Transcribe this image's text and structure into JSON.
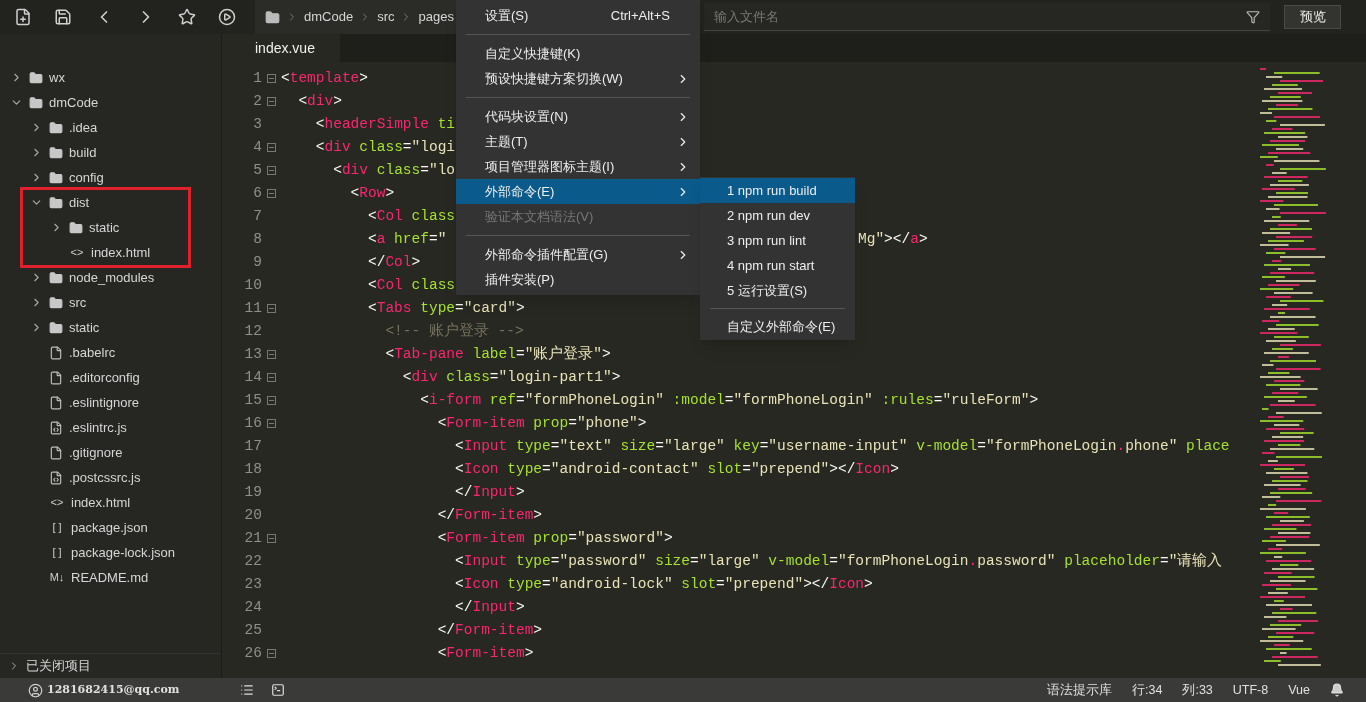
{
  "toolbar": {
    "breadcrumb": [
      "dmCode",
      "src",
      "pages"
    ],
    "search": {
      "placeholder": "输入文件名"
    },
    "preview_button": "预览"
  },
  "sidebar": {
    "tree": [
      {
        "label": "wx",
        "kind": "folder",
        "expanded": false
      },
      {
        "label": "dmCode",
        "kind": "folder",
        "expanded": true,
        "children": [
          {
            "label": ".idea",
            "kind": "folder",
            "expanded": false
          },
          {
            "label": "build",
            "kind": "folder",
            "expanded": false
          },
          {
            "label": "config",
            "kind": "folder",
            "expanded": false
          },
          {
            "label": "dist",
            "kind": "folder",
            "expanded": true,
            "highlighted": true,
            "children": [
              {
                "label": "static",
                "kind": "folder",
                "expanded": false
              },
              {
                "label": "index.html",
                "kind": "markup",
                "glyph": "<>"
              }
            ]
          },
          {
            "label": "node_modules",
            "kind": "folder",
            "expanded": false
          },
          {
            "label": "src",
            "kind": "folder",
            "expanded": false
          },
          {
            "label": "static",
            "kind": "folder",
            "expanded": false
          },
          {
            "label": ".babelrc",
            "kind": "file"
          },
          {
            "label": ".editorconfig",
            "kind": "file"
          },
          {
            "label": ".eslintignore",
            "kind": "file"
          },
          {
            "label": ".eslintrc.js",
            "kind": "script"
          },
          {
            "label": ".gitignore",
            "kind": "file"
          },
          {
            "label": ".postcssrc.js",
            "kind": "script"
          },
          {
            "label": "index.html",
            "kind": "markup",
            "glyph": "<>"
          },
          {
            "label": "package.json",
            "kind": "json",
            "glyph": "[ ]"
          },
          {
            "label": "package-lock.json",
            "kind": "json",
            "glyph": "[ ]"
          },
          {
            "label": "README.md",
            "kind": "markdown",
            "glyph": "M↓"
          }
        ]
      }
    ],
    "closed_projects": {
      "label": "已关闭项目",
      "expanded": false
    }
  },
  "tabs": [
    {
      "label": "index.vue",
      "selected": true
    }
  ],
  "editor": {
    "lines": [
      {
        "number": "1",
        "fold": true,
        "tokens": [
          {
            "kind": "punct",
            "text": "<"
          },
          {
            "kind": "tag",
            "text": "template"
          },
          {
            "kind": "punct",
            "text": ">"
          }
        ]
      },
      {
        "number": "2",
        "fold": true,
        "tokens": [
          {
            "kind": "punct",
            "text": "  <"
          },
          {
            "kind": "tag",
            "text": "div"
          },
          {
            "kind": "punct",
            "text": ">"
          }
        ]
      },
      {
        "number": "3",
        "fold": false,
        "tokens": [
          {
            "kind": "punct",
            "text": "    <"
          },
          {
            "kind": "tag",
            "text": "headerSimple"
          },
          {
            "kind": "attr",
            "text": " ti"
          }
        ]
      },
      {
        "number": "4",
        "fold": true,
        "tokens": [
          {
            "kind": "punct",
            "text": "    <"
          },
          {
            "kind": "tag",
            "text": "div"
          },
          {
            "kind": "attr",
            "text": " class"
          },
          {
            "kind": "punct",
            "text": "="
          },
          {
            "kind": "string",
            "text": "\"logi"
          }
        ]
      },
      {
        "number": "5",
        "fold": true,
        "tokens": [
          {
            "kind": "punct",
            "text": "      <"
          },
          {
            "kind": "tag",
            "text": "div"
          },
          {
            "kind": "attr",
            "text": " class"
          },
          {
            "kind": "punct",
            "text": "="
          },
          {
            "kind": "string",
            "text": "\"lo"
          }
        ]
      },
      {
        "number": "6",
        "fold": true,
        "tokens": [
          {
            "kind": "punct",
            "text": "        <"
          },
          {
            "kind": "tag",
            "text": "Row"
          },
          {
            "kind": "punct",
            "text": ">"
          }
        ]
      },
      {
        "number": "7",
        "fold": false,
        "tokens": [
          {
            "kind": "punct",
            "text": "          <"
          },
          {
            "kind": "tag",
            "text": "Col"
          },
          {
            "kind": "attr",
            "text": " class"
          }
        ]
      },
      {
        "number": "8",
        "fold": false,
        "tokens": [
          {
            "kind": "punct",
            "text": "          <"
          },
          {
            "kind": "tag",
            "text": "a"
          },
          {
            "kind": "attr",
            "text": " href"
          },
          {
            "kind": "punct",
            "text": "="
          },
          {
            "kind": "string",
            "text": "\""
          }
        ],
        "tail": [
          {
            "kind": "string",
            "text": "Mg\""
          },
          {
            "kind": "punct",
            "text": "></"
          },
          {
            "kind": "tag",
            "text": "a"
          },
          {
            "kind": "punct",
            "text": ">"
          }
        ]
      },
      {
        "number": "9",
        "fold": false,
        "tokens": [
          {
            "kind": "punct",
            "text": "          </"
          },
          {
            "kind": "tag",
            "text": "Col"
          },
          {
            "kind": "punct",
            "text": ">"
          }
        ]
      },
      {
        "number": "10",
        "fold": false,
        "tokens": [
          {
            "kind": "punct",
            "text": "          <"
          },
          {
            "kind": "tag",
            "text": "Col"
          },
          {
            "kind": "attr",
            "text": " class"
          }
        ]
      },
      {
        "number": "11",
        "fold": true,
        "tokens": [
          {
            "kind": "punct",
            "text": "          <"
          },
          {
            "kind": "tag",
            "text": "Tabs"
          },
          {
            "kind": "attr",
            "text": " type"
          },
          {
            "kind": "punct",
            "text": "="
          },
          {
            "kind": "string",
            "text": "\"card\""
          },
          {
            "kind": "punct",
            "text": ">"
          }
        ]
      },
      {
        "number": "12",
        "fold": false,
        "tokens": [
          {
            "kind": "comment",
            "text": "            <!-- 账户登录 -->"
          }
        ]
      },
      {
        "number": "13",
        "fold": true,
        "tokens": [
          {
            "kind": "punct",
            "text": "            <"
          },
          {
            "kind": "tag",
            "text": "Tab-pane"
          },
          {
            "kind": "attr",
            "text": " label"
          },
          {
            "kind": "punct",
            "text": "="
          },
          {
            "kind": "string",
            "text": "\"账户登录\""
          },
          {
            "kind": "punct",
            "text": ">"
          }
        ]
      },
      {
        "number": "14",
        "fold": true,
        "tokens": [
          {
            "kind": "punct",
            "text": "              <"
          },
          {
            "kind": "tag",
            "text": "div"
          },
          {
            "kind": "attr",
            "text": " class"
          },
          {
            "kind": "punct",
            "text": "="
          },
          {
            "kind": "string",
            "text": "\"login-part1\""
          },
          {
            "kind": "punct",
            "text": ">"
          }
        ]
      },
      {
        "number": "15",
        "fold": true,
        "tokens": [
          {
            "kind": "punct",
            "text": "                <"
          },
          {
            "kind": "tag",
            "text": "i-form"
          },
          {
            "kind": "attr",
            "text": " ref"
          },
          {
            "kind": "punct",
            "text": "="
          },
          {
            "kind": "string",
            "text": "\"formPhoneLogin\""
          },
          {
            "kind": "attr",
            "text": " :model"
          },
          {
            "kind": "punct",
            "text": "="
          },
          {
            "kind": "string",
            "text": "\"formPhoneLogin\""
          },
          {
            "kind": "attr",
            "text": " :rules"
          },
          {
            "kind": "punct",
            "text": "="
          },
          {
            "kind": "string",
            "text": "\"ruleForm\""
          },
          {
            "kind": "punct",
            "text": ">"
          }
        ]
      },
      {
        "number": "16",
        "fold": true,
        "tokens": [
          {
            "kind": "punct",
            "text": "                  <"
          },
          {
            "kind": "tag",
            "text": "Form-item"
          },
          {
            "kind": "attr",
            "text": " prop"
          },
          {
            "kind": "punct",
            "text": "="
          },
          {
            "kind": "string",
            "text": "\"phone\""
          },
          {
            "kind": "punct",
            "text": ">"
          }
        ]
      },
      {
        "number": "17",
        "fold": false,
        "tokens": [
          {
            "kind": "punct",
            "text": "                    <"
          },
          {
            "kind": "tag",
            "text": "Input"
          },
          {
            "kind": "attr",
            "text": " type"
          },
          {
            "kind": "punct",
            "text": "="
          },
          {
            "kind": "string",
            "text": "\"text\""
          },
          {
            "kind": "attr",
            "text": " size"
          },
          {
            "kind": "punct",
            "text": "="
          },
          {
            "kind": "string",
            "text": "\"large\""
          },
          {
            "kind": "attr",
            "text": " key"
          },
          {
            "kind": "punct",
            "text": "="
          },
          {
            "kind": "string",
            "text": "\"username-input\""
          },
          {
            "kind": "attr",
            "text": " v-model"
          },
          {
            "kind": "punct",
            "text": "="
          },
          {
            "kind": "string",
            "text": "\"formPhoneLogin"
          },
          {
            "kind": "tag",
            "text": "."
          },
          {
            "kind": "string",
            "text": "phone\""
          },
          {
            "kind": "attr",
            "text": " place"
          }
        ]
      },
      {
        "number": "18",
        "fold": false,
        "tokens": [
          {
            "kind": "punct",
            "text": "                    <"
          },
          {
            "kind": "tag",
            "text": "Icon"
          },
          {
            "kind": "attr",
            "text": " type"
          },
          {
            "kind": "punct",
            "text": "="
          },
          {
            "kind": "string",
            "text": "\"android-contact\""
          },
          {
            "kind": "attr",
            "text": " slot"
          },
          {
            "kind": "punct",
            "text": "="
          },
          {
            "kind": "string",
            "text": "\"prepend\""
          },
          {
            "kind": "punct",
            "text": "></"
          },
          {
            "kind": "tag",
            "text": "Icon"
          },
          {
            "kind": "punct",
            "text": ">"
          }
        ]
      },
      {
        "number": "19",
        "fold": false,
        "tokens": [
          {
            "kind": "punct",
            "text": "                    </"
          },
          {
            "kind": "tag",
            "text": "Input"
          },
          {
            "kind": "punct",
            "text": ">"
          }
        ]
      },
      {
        "number": "20",
        "fold": false,
        "tokens": [
          {
            "kind": "punct",
            "text": "                  </"
          },
          {
            "kind": "tag",
            "text": "Form-item"
          },
          {
            "kind": "punct",
            "text": ">"
          }
        ]
      },
      {
        "number": "21",
        "fold": true,
        "tokens": [
          {
            "kind": "punct",
            "text": "                  <"
          },
          {
            "kind": "tag",
            "text": "Form-item"
          },
          {
            "kind": "attr",
            "text": " prop"
          },
          {
            "kind": "punct",
            "text": "="
          },
          {
            "kind": "string",
            "text": "\"password\""
          },
          {
            "kind": "punct",
            "text": ">"
          }
        ]
      },
      {
        "number": "22",
        "fold": false,
        "tokens": [
          {
            "kind": "punct",
            "text": "                    <"
          },
          {
            "kind": "tag",
            "text": "Input"
          },
          {
            "kind": "attr",
            "text": " type"
          },
          {
            "kind": "punct",
            "text": "="
          },
          {
            "kind": "string",
            "text": "\"password\""
          },
          {
            "kind": "attr",
            "text": " size"
          },
          {
            "kind": "punct",
            "text": "="
          },
          {
            "kind": "string",
            "text": "\"large\""
          },
          {
            "kind": "attr",
            "text": " v-model"
          },
          {
            "kind": "punct",
            "text": "="
          },
          {
            "kind": "string",
            "text": "\"formPhoneLogin"
          },
          {
            "kind": "tag",
            "text": "."
          },
          {
            "kind": "string",
            "text": "password\""
          },
          {
            "kind": "attr",
            "text": " placeholder"
          },
          {
            "kind": "punct",
            "text": "="
          },
          {
            "kind": "string",
            "text": "\"请输入"
          }
        ]
      },
      {
        "number": "23",
        "fold": false,
        "tokens": [
          {
            "kind": "punct",
            "text": "                    <"
          },
          {
            "kind": "tag",
            "text": "Icon"
          },
          {
            "kind": "attr",
            "text": " type"
          },
          {
            "kind": "punct",
            "text": "="
          },
          {
            "kind": "string",
            "text": "\"android-lock\""
          },
          {
            "kind": "attr",
            "text": " slot"
          },
          {
            "kind": "punct",
            "text": "="
          },
          {
            "kind": "string",
            "text": "\"prepend\""
          },
          {
            "kind": "punct",
            "text": "></"
          },
          {
            "kind": "tag",
            "text": "Icon"
          },
          {
            "kind": "punct",
            "text": ">"
          }
        ]
      },
      {
        "number": "24",
        "fold": false,
        "tokens": [
          {
            "kind": "punct",
            "text": "                    </"
          },
          {
            "kind": "tag",
            "text": "Input"
          },
          {
            "kind": "punct",
            "text": ">"
          }
        ]
      },
      {
        "number": "25",
        "fold": false,
        "tokens": [
          {
            "kind": "punct",
            "text": "                  </"
          },
          {
            "kind": "tag",
            "text": "Form-item"
          },
          {
            "kind": "punct",
            "text": ">"
          }
        ]
      },
      {
        "number": "26",
        "fold": true,
        "tokens": [
          {
            "kind": "punct",
            "text": "                  <"
          },
          {
            "kind": "tag",
            "text": "Form-item"
          },
          {
            "kind": "punct",
            "text": ">"
          }
        ]
      }
    ]
  },
  "menu": {
    "items": [
      {
        "kind": "item",
        "label": "设置(S)",
        "shortcut": "Ctrl+Alt+S",
        "submenu": false,
        "disabled": false,
        "selected": false
      },
      {
        "kind": "separator"
      },
      {
        "kind": "item",
        "label": "自定义快捷键(K)",
        "submenu": false,
        "disabled": false,
        "selected": false
      },
      {
        "kind": "item",
        "label": "预设快捷键方案切换(W)",
        "submenu": true,
        "disabled": false,
        "selected": false
      },
      {
        "kind": "separator"
      },
      {
        "kind": "item",
        "label": "代码块设置(N)",
        "submenu": true,
        "disabled": false,
        "selected": false
      },
      {
        "kind": "item",
        "label": "主题(T)",
        "submenu": true,
        "disabled": false,
        "selected": false
      },
      {
        "kind": "item",
        "label": "项目管理器图标主题(I)",
        "submenu": true,
        "disabled": false,
        "selected": false
      },
      {
        "kind": "item",
        "label": "外部命令(E)",
        "submenu": true,
        "disabled": false,
        "selected": true
      },
      {
        "kind": "item",
        "label": "验证本文档语法(V)",
        "submenu": false,
        "disabled": true,
        "selected": false
      },
      {
        "kind": "separator"
      },
      {
        "kind": "item",
        "label": "外部命令插件配置(G)",
        "submenu": true,
        "disabled": false,
        "selected": false
      },
      {
        "kind": "item",
        "label": "插件安装(P)",
        "submenu": false,
        "disabled": false,
        "selected": false
      }
    ]
  },
  "submenu": {
    "items": [
      {
        "kind": "item",
        "label": "1 npm run build",
        "selected": true
      },
      {
        "kind": "item",
        "label": "2 npm run dev",
        "selected": false
      },
      {
        "kind": "item",
        "label": "3 npm run lint",
        "selected": false
      },
      {
        "kind": "item",
        "label": "4 npm run start",
        "selected": false
      },
      {
        "kind": "item",
        "label": "5 运行设置(S)",
        "selected": false
      },
      {
        "kind": "separator"
      },
      {
        "kind": "item",
        "label": "自定义外部命令(E)",
        "selected": false
      }
    ]
  },
  "status_bar": {
    "account": "1281682415@qq.com",
    "items": [
      "语法提示库",
      "行:34",
      "列:33",
      "UTF-8",
      "Vue"
    ]
  }
}
